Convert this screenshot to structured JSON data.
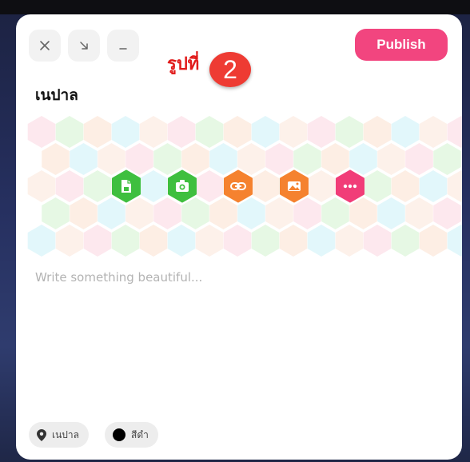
{
  "window": {
    "controls": [
      {
        "name": "close",
        "icon": "close-icon"
      },
      {
        "name": "expand",
        "icon": "arrow-down-right-icon"
      },
      {
        "name": "minimize",
        "icon": "minimize-icon"
      }
    ],
    "publish_label": "Publish"
  },
  "annotation": {
    "text": "รูปที่",
    "number": "2"
  },
  "post": {
    "title": "เนปาล",
    "placeholder": "Write something beautiful..."
  },
  "toolbar": {
    "buttons": [
      {
        "name": "attach-file",
        "icon": "file-icon",
        "color": "#3fbf3f"
      },
      {
        "name": "add-photo",
        "icon": "camera-icon",
        "color": "#3fbf3f"
      },
      {
        "name": "add-link",
        "icon": "link-icon",
        "color": "#f5822f"
      },
      {
        "name": "add-image",
        "icon": "image-icon",
        "color": "#f5822f"
      },
      {
        "name": "more",
        "icon": "more-icon",
        "color": "#f13d78"
      }
    ]
  },
  "chips": {
    "location": {
      "icon": "location-pin-icon",
      "label": "เนปาล"
    },
    "color": {
      "icon": "color-dot-icon",
      "label": "สีดำ"
    }
  },
  "colors": {
    "accent": "#f2457f",
    "hex_palette": [
      "#fde8ee",
      "#e6f8e4",
      "#fdeee4",
      "#e2f7fb",
      "#fdf1ea"
    ]
  }
}
